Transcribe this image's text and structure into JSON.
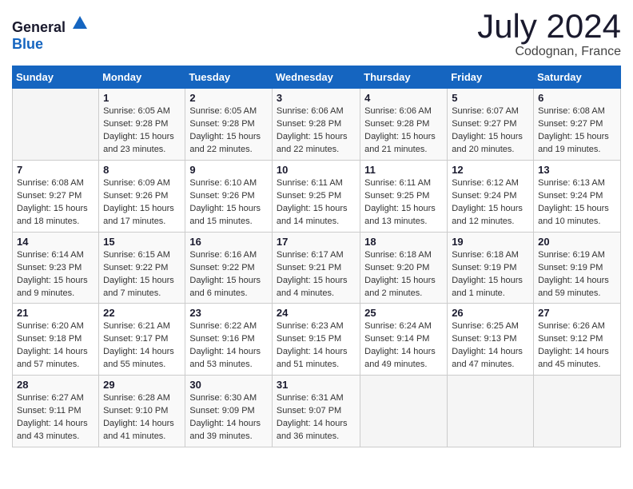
{
  "logo": {
    "general": "General",
    "blue": "Blue"
  },
  "title": {
    "month": "July 2024",
    "location": "Codognan, France"
  },
  "weekdays": [
    "Sunday",
    "Monday",
    "Tuesday",
    "Wednesday",
    "Thursday",
    "Friday",
    "Saturday"
  ],
  "weeks": [
    [
      {
        "day": "",
        "content": ""
      },
      {
        "day": "1",
        "content": "Sunrise: 6:05 AM\nSunset: 9:28 PM\nDaylight: 15 hours\nand 23 minutes."
      },
      {
        "day": "2",
        "content": "Sunrise: 6:05 AM\nSunset: 9:28 PM\nDaylight: 15 hours\nand 22 minutes."
      },
      {
        "day": "3",
        "content": "Sunrise: 6:06 AM\nSunset: 9:28 PM\nDaylight: 15 hours\nand 22 minutes."
      },
      {
        "day": "4",
        "content": "Sunrise: 6:06 AM\nSunset: 9:28 PM\nDaylight: 15 hours\nand 21 minutes."
      },
      {
        "day": "5",
        "content": "Sunrise: 6:07 AM\nSunset: 9:27 PM\nDaylight: 15 hours\nand 20 minutes."
      },
      {
        "day": "6",
        "content": "Sunrise: 6:08 AM\nSunset: 9:27 PM\nDaylight: 15 hours\nand 19 minutes."
      }
    ],
    [
      {
        "day": "7",
        "content": "Sunrise: 6:08 AM\nSunset: 9:27 PM\nDaylight: 15 hours\nand 18 minutes."
      },
      {
        "day": "8",
        "content": "Sunrise: 6:09 AM\nSunset: 9:26 PM\nDaylight: 15 hours\nand 17 minutes."
      },
      {
        "day": "9",
        "content": "Sunrise: 6:10 AM\nSunset: 9:26 PM\nDaylight: 15 hours\nand 15 minutes."
      },
      {
        "day": "10",
        "content": "Sunrise: 6:11 AM\nSunset: 9:25 PM\nDaylight: 15 hours\nand 14 minutes."
      },
      {
        "day": "11",
        "content": "Sunrise: 6:11 AM\nSunset: 9:25 PM\nDaylight: 15 hours\nand 13 minutes."
      },
      {
        "day": "12",
        "content": "Sunrise: 6:12 AM\nSunset: 9:24 PM\nDaylight: 15 hours\nand 12 minutes."
      },
      {
        "day": "13",
        "content": "Sunrise: 6:13 AM\nSunset: 9:24 PM\nDaylight: 15 hours\nand 10 minutes."
      }
    ],
    [
      {
        "day": "14",
        "content": "Sunrise: 6:14 AM\nSunset: 9:23 PM\nDaylight: 15 hours\nand 9 minutes."
      },
      {
        "day": "15",
        "content": "Sunrise: 6:15 AM\nSunset: 9:22 PM\nDaylight: 15 hours\nand 7 minutes."
      },
      {
        "day": "16",
        "content": "Sunrise: 6:16 AM\nSunset: 9:22 PM\nDaylight: 15 hours\nand 6 minutes."
      },
      {
        "day": "17",
        "content": "Sunrise: 6:17 AM\nSunset: 9:21 PM\nDaylight: 15 hours\nand 4 minutes."
      },
      {
        "day": "18",
        "content": "Sunrise: 6:18 AM\nSunset: 9:20 PM\nDaylight: 15 hours\nand 2 minutes."
      },
      {
        "day": "19",
        "content": "Sunrise: 6:18 AM\nSunset: 9:19 PM\nDaylight: 15 hours\nand 1 minute."
      },
      {
        "day": "20",
        "content": "Sunrise: 6:19 AM\nSunset: 9:19 PM\nDaylight: 14 hours\nand 59 minutes."
      }
    ],
    [
      {
        "day": "21",
        "content": "Sunrise: 6:20 AM\nSunset: 9:18 PM\nDaylight: 14 hours\nand 57 minutes."
      },
      {
        "day": "22",
        "content": "Sunrise: 6:21 AM\nSunset: 9:17 PM\nDaylight: 14 hours\nand 55 minutes."
      },
      {
        "day": "23",
        "content": "Sunrise: 6:22 AM\nSunset: 9:16 PM\nDaylight: 14 hours\nand 53 minutes."
      },
      {
        "day": "24",
        "content": "Sunrise: 6:23 AM\nSunset: 9:15 PM\nDaylight: 14 hours\nand 51 minutes."
      },
      {
        "day": "25",
        "content": "Sunrise: 6:24 AM\nSunset: 9:14 PM\nDaylight: 14 hours\nand 49 minutes."
      },
      {
        "day": "26",
        "content": "Sunrise: 6:25 AM\nSunset: 9:13 PM\nDaylight: 14 hours\nand 47 minutes."
      },
      {
        "day": "27",
        "content": "Sunrise: 6:26 AM\nSunset: 9:12 PM\nDaylight: 14 hours\nand 45 minutes."
      }
    ],
    [
      {
        "day": "28",
        "content": "Sunrise: 6:27 AM\nSunset: 9:11 PM\nDaylight: 14 hours\nand 43 minutes."
      },
      {
        "day": "29",
        "content": "Sunrise: 6:28 AM\nSunset: 9:10 PM\nDaylight: 14 hours\nand 41 minutes."
      },
      {
        "day": "30",
        "content": "Sunrise: 6:30 AM\nSunset: 9:09 PM\nDaylight: 14 hours\nand 39 minutes."
      },
      {
        "day": "31",
        "content": "Sunrise: 6:31 AM\nSunset: 9:07 PM\nDaylight: 14 hours\nand 36 minutes."
      },
      {
        "day": "",
        "content": ""
      },
      {
        "day": "",
        "content": ""
      },
      {
        "day": "",
        "content": ""
      }
    ]
  ]
}
